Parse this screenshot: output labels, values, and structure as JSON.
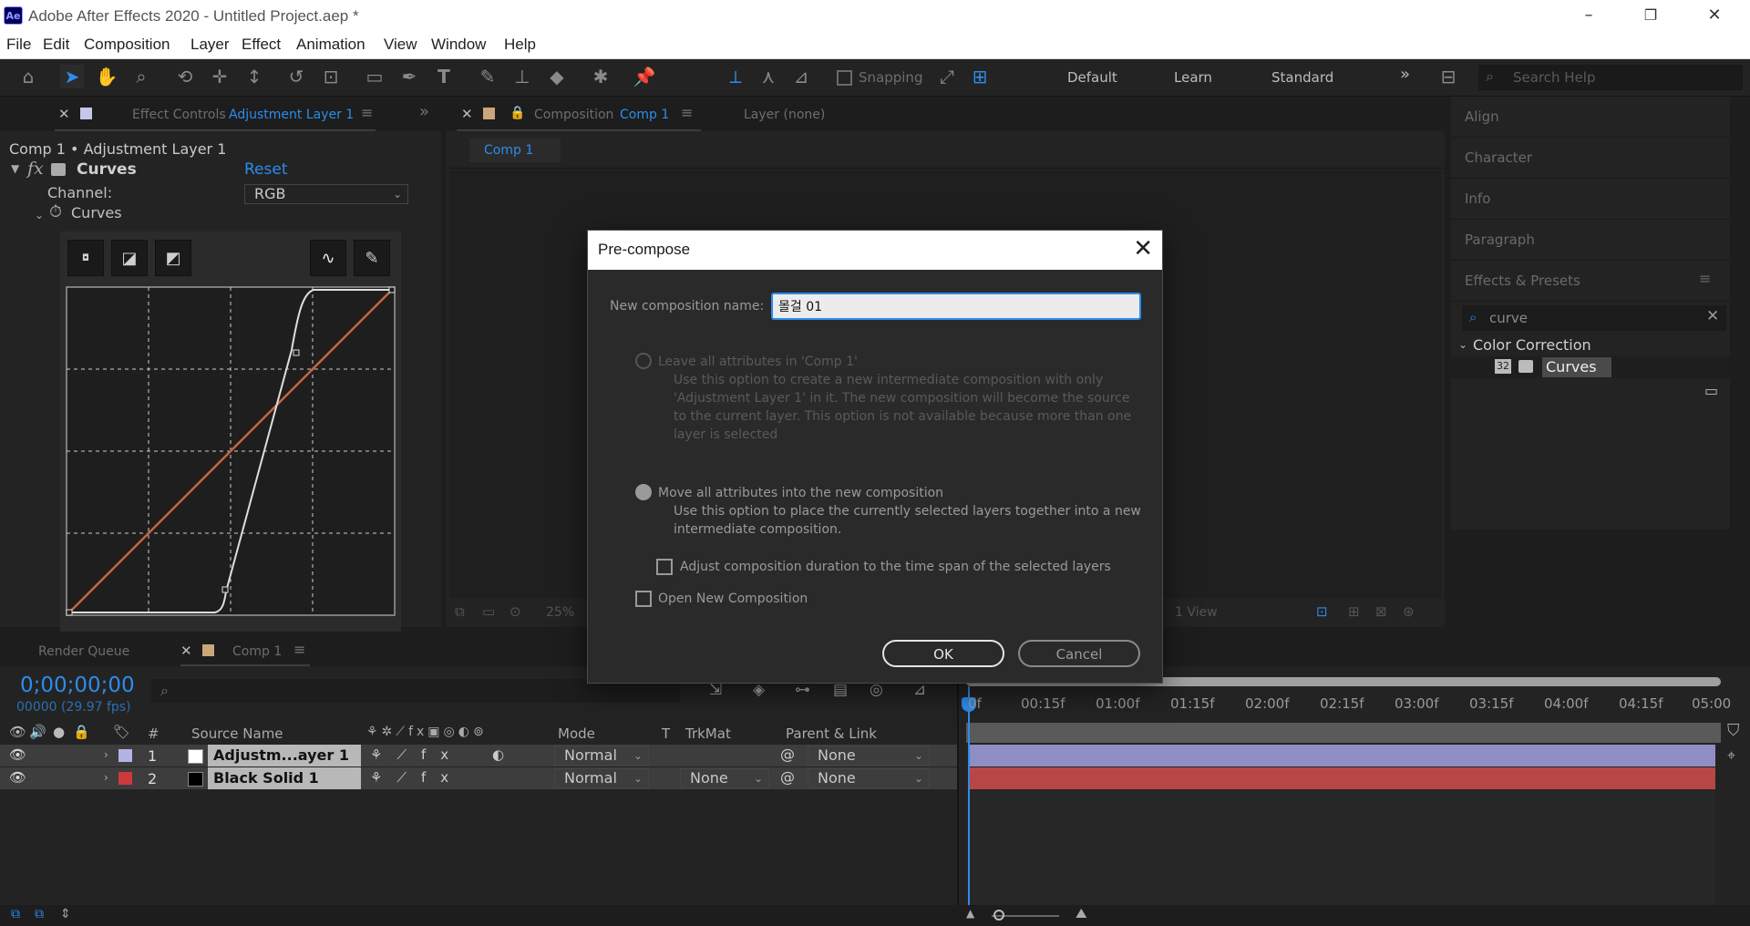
{
  "window": {
    "title": "Adobe After Effects 2020 - Untitled Project.aep *",
    "logo": "Ae",
    "controls": {
      "minimize": "–",
      "restore": "❐",
      "close": "✕"
    }
  },
  "menu": [
    "File",
    "Edit",
    "Composition",
    "Layer",
    "Effect",
    "Animation",
    "View",
    "Window",
    "Help"
  ],
  "toolbar": {
    "snapping_label": "Snapping",
    "workspaces": [
      "Default",
      "Learn",
      "Standard"
    ],
    "overflow": "»",
    "search_placeholder": "Search Help"
  },
  "effect_controls": {
    "tab_prefix": "Effect Controls",
    "tab_layer": "Adjustment Layer 1",
    "breadcrumb": "Comp 1 • Adjustment Layer 1",
    "fx_label": "fx",
    "effect_name": "Curves",
    "reset": "Reset",
    "channel_label": "Channel:",
    "channel_value": "RGB",
    "curves_prop": "Curves"
  },
  "composition_panel": {
    "tab_prefix": "Composition",
    "tab_comp": "Comp 1",
    "layer_tab": "Layer (none)",
    "subtab": "Comp 1",
    "zoom": "25%",
    "view": "1 View"
  },
  "right_panel": {
    "sections": [
      "Align",
      "Character",
      "Info",
      "Paragraph",
      "Effects & Presets"
    ],
    "search_value": "curve",
    "category": "Color Correction",
    "item_badge": "32",
    "item": "Curves"
  },
  "dialog": {
    "title": "Pre-compose",
    "name_label": "New composition name:",
    "name_value": "몰걸 01",
    "option1_title": "Leave all attributes in 'Comp 1'",
    "option1_desc": [
      "Use this option to create a new intermediate composition with only",
      "'Adjustment Layer 1' in it. The new composition will become the source",
      "to the current layer. This option is not available because more than one",
      "layer is selected"
    ],
    "option2_title": "Move all attributes into the new composition",
    "option2_desc": [
      "Use this option to place the currently selected layers together into a new",
      "intermediate composition."
    ],
    "adjust_duration": "Adjust composition duration to the time span of the selected layers",
    "open_new": "Open New Composition",
    "ok": "OK",
    "cancel": "Cancel"
  },
  "timeline": {
    "render_queue_tab": "Render Queue",
    "comp_tab": "Comp 1",
    "timecode": "0;00;00;00",
    "frame_info": "00000 (29.97 fps)",
    "columns": {
      "num": "#",
      "source_name": "Source Name",
      "mode": "Mode",
      "t": "T",
      "trkmat": "TrkMat",
      "parent": "Parent & Link"
    },
    "ruler": [
      "0f",
      "00:15f",
      "01:00f",
      "01:15f",
      "02:00f",
      "02:15f",
      "03:00f",
      "03:15f",
      "04:00f",
      "04:15f",
      "05:00"
    ],
    "layers": [
      {
        "num": "1",
        "name": "Adjustm...ayer 1",
        "mode": "Normal",
        "trkmat": "",
        "parent": "None",
        "label_color": "#b3b3e6",
        "swatch": "#ffffff",
        "bar_color": "#9090c8"
      },
      {
        "num": "2",
        "name": "Black Solid 1",
        "mode": "Normal",
        "trkmat": "None",
        "parent": "None",
        "label_color": "#cc3a3a",
        "swatch": "#000000",
        "bar_color": "#b84545"
      }
    ]
  }
}
